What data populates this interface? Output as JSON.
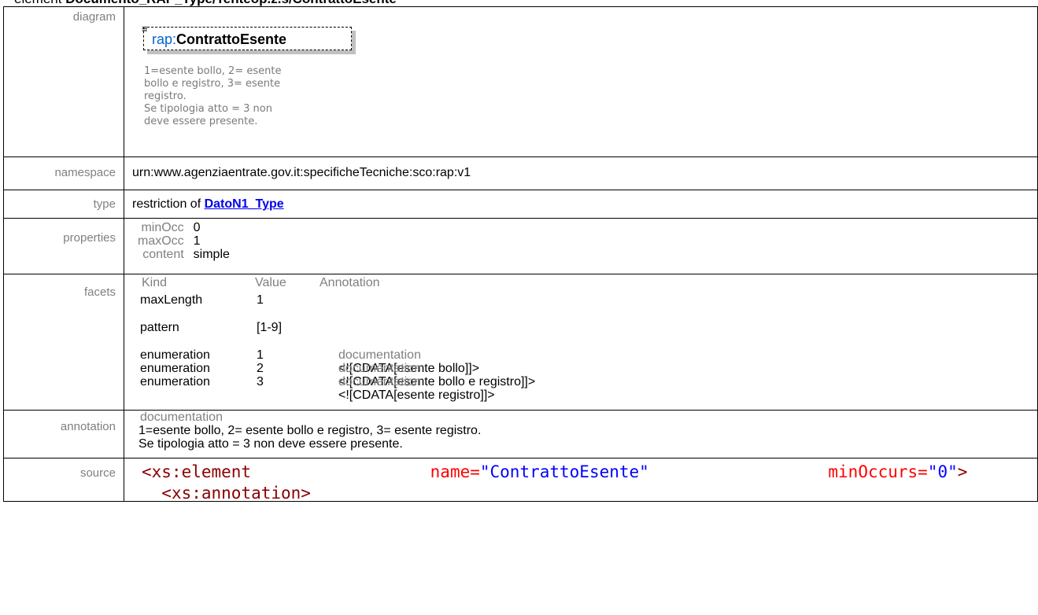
{
  "header": {
    "prefix": "element",
    "name": "Documento_RAP_Type/Tenteop.z.s/ContrattoEsente"
  },
  "labels": {
    "diagram": "diagram",
    "namespace": "namespace",
    "type": "type",
    "properties": "properties",
    "facets": "facets",
    "annotation": "annotation",
    "source": "source"
  },
  "diagram": {
    "prefix": "rap:",
    "element": "ContrattoEsente",
    "note": [
      "1=esente bollo, 2= esente",
      "bollo e registro, 3= esente",
      "registro.",
      "Se tipologia atto = 3 non",
      "deve essere presente."
    ]
  },
  "namespace": "urn:www.agenziaentrate.gov.it:specificheTecniche:sco:rap:v1",
  "type": {
    "prefix": "restriction of ",
    "link": "DatoN1_Type"
  },
  "properties": [
    {
      "key": "minOcc",
      "value": "0"
    },
    {
      "key": "maxOcc",
      "value": "1"
    },
    {
      "key": "content",
      "value": "simple"
    }
  ],
  "facets": {
    "headers": {
      "kind": "Kind",
      "value": "Value",
      "annotation": "Annotation"
    },
    "rows": [
      {
        "kind": "maxLength",
        "value": "1"
      },
      {
        "kind": "pattern",
        "value": "[1-9]"
      },
      {
        "kind": "enumeration",
        "value": "1",
        "doc_label": "documentation",
        "doc": "<![CDATA[esente bollo]]>"
      },
      {
        "kind": "enumeration",
        "value": "2",
        "doc_label": "documentation",
        "doc": "<![CDATA[esente bollo e registro]]>"
      },
      {
        "kind": "enumeration",
        "value": "3",
        "doc_label": "documentation",
        "doc": "<![CDATA[esente registro]]>"
      }
    ]
  },
  "annotation": {
    "label": "documentation",
    "lines": [
      "1=esente bollo, 2= esente bollo e registro, 3= esente registro.",
      "Se tipologia atto = 3 non deve essere presente."
    ]
  },
  "source": {
    "line1": {
      "tag": "<xs:element",
      "attr1": "name=",
      "val1": "\"ContrattoEsente\"",
      "attr2": "minOccurs=",
      "val2": "\"0\"",
      "close": ">"
    },
    "line2": "<xs:annotation>"
  }
}
